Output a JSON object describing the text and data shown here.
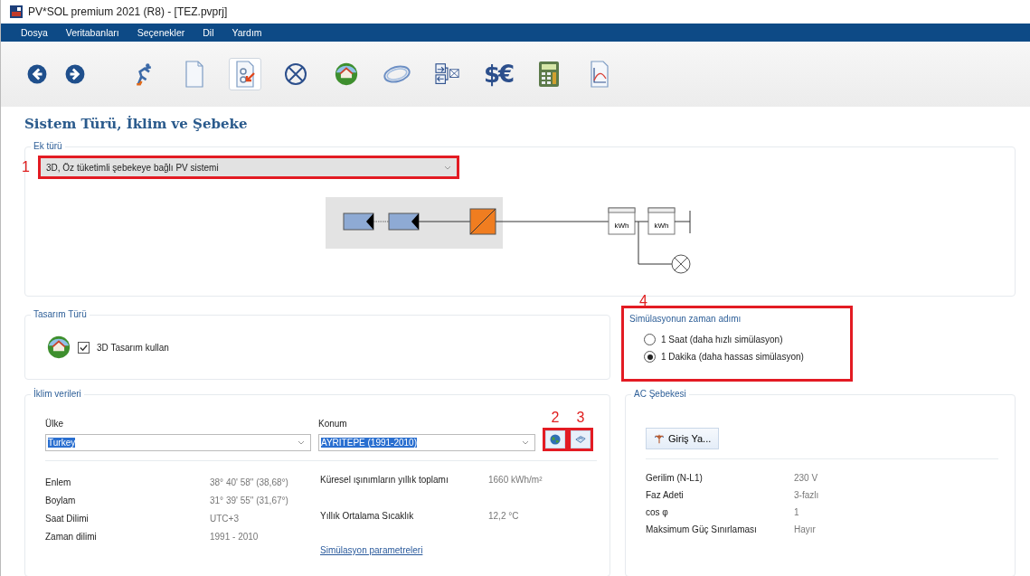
{
  "window": {
    "title": "PV*SOL premium 2021 (R8) - [TEZ.pvprj]"
  },
  "menu": [
    "Dosya",
    "Veritabanları",
    "Seçenekler",
    "Dil",
    "Yardım"
  ],
  "toolbar": [
    {
      "kind": "back",
      "selected": false
    },
    {
      "kind": "forward",
      "selected": false
    },
    {
      "kind": "runner",
      "selected": false
    },
    {
      "kind": "page",
      "selected": false
    },
    {
      "kind": "settings-page",
      "selected": true
    },
    {
      "kind": "cross-circle",
      "selected": false
    },
    {
      "kind": "house-globe",
      "selected": false
    },
    {
      "kind": "ring",
      "selected": false
    },
    {
      "kind": "switch",
      "selected": false
    },
    {
      "kind": "currency",
      "label": "$€",
      "selected": false
    },
    {
      "kind": "calculator",
      "selected": false
    },
    {
      "kind": "chart-page",
      "selected": false
    }
  ],
  "page_title": "Sistem Türü, İklim ve Şebeke",
  "connection_type": {
    "legend": "Ek türü",
    "annotation": "1",
    "value": "3D, Öz tüketimli şebekeye bağlı PV sistemi",
    "meters": [
      "kWh",
      "kWh"
    ]
  },
  "design_type": {
    "legend": "Tasarım Türü",
    "checkbox": {
      "label": "3D Tasarım kullan",
      "checked": true
    }
  },
  "time_step": {
    "legend": "Simülasyonun zaman adımı",
    "annotation": "4",
    "options": [
      {
        "label": "1 Saat (daha hızlı simülasyon)",
        "selected": false
      },
      {
        "label": "1 Dakika (daha hassas simülasyon)",
        "selected": true
      }
    ]
  },
  "climate": {
    "legend": "İklim verileri",
    "country": {
      "label": "Ülke",
      "value": "Turkey"
    },
    "location": {
      "label": "Konum",
      "value": "AYRITEPE (1991-2010)"
    },
    "buttons": [
      {
        "kind": "globe",
        "annotation": "2"
      },
      {
        "kind": "map",
        "annotation": "3"
      }
    ],
    "left_rows": [
      {
        "label": "Enlem",
        "value": "38° 40' 58\"  (38,68°)"
      },
      {
        "label": "Boylam",
        "value": "31° 39' 55\"  (31,67°)"
      },
      {
        "label": "Saat Dilimi",
        "value": "UTC+3"
      },
      {
        "label": "Zaman dilimi",
        "value": "1991 - 2010"
      }
    ],
    "right_rows": [
      {
        "label": "Küresel ışınımların yıllık toplamı",
        "value": "1660 kWh/m²"
      },
      {
        "label": "Yıllık Ortalama Sıcaklık",
        "value": "12,2 °C"
      }
    ],
    "link": "Simülasyon parametreleri"
  },
  "ac_grid": {
    "legend": "AC Şebekesi",
    "button": "Giriş Ya...",
    "rows": [
      {
        "label": "Gerilim (N-L1)",
        "value": "230 V"
      },
      {
        "label": "Faz Adeti",
        "value": "3-fazlı"
      },
      {
        "label": "cos φ",
        "value": "1"
      },
      {
        "label": "Maksimum Güç Sınırlaması",
        "value": "Hayır"
      }
    ]
  }
}
